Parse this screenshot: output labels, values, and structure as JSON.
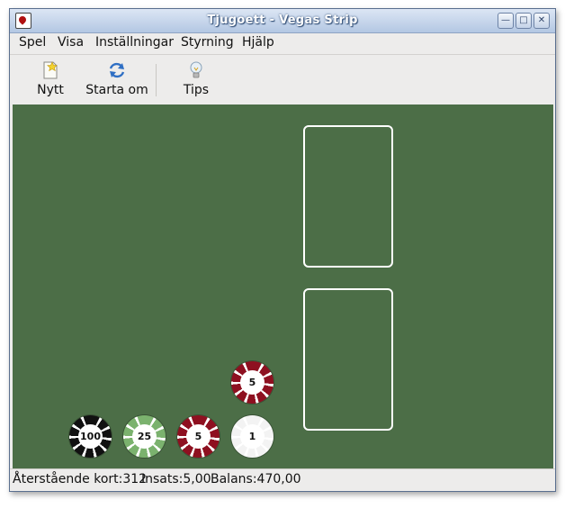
{
  "window": {
    "title": "Tjugoett - Vegas Strip"
  },
  "menubar": {
    "items": [
      "Spel",
      "Visa",
      "Inställningar",
      "Styrning",
      "Hjälp"
    ]
  },
  "toolbar": {
    "new_label": "Nytt",
    "restart_label": "Starta om",
    "hint_label": "Tips"
  },
  "table": {
    "felt_color": "#4c6e47",
    "chips": [
      {
        "value": "100",
        "color": "#111111"
      },
      {
        "value": "25",
        "color": "#7bb26e"
      },
      {
        "value": "5",
        "color": "#8e1020"
      },
      {
        "value": "1",
        "color": "#f3f3f3"
      },
      {
        "value": "5",
        "color": "#8e1020"
      }
    ]
  },
  "status": {
    "cards_left": "Återstående kort:312",
    "bet": "Insats:5,00",
    "balance": "Balans:470,00"
  }
}
